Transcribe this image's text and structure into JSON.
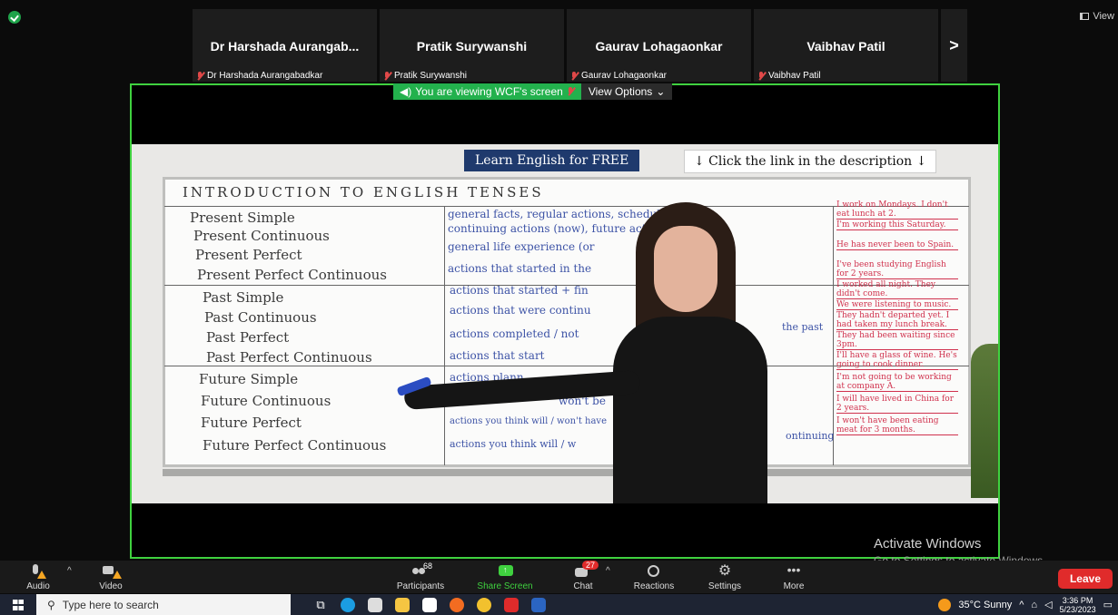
{
  "top": {
    "view_label": "View"
  },
  "participants": [
    {
      "name": "Dr Harshada Aurangab...",
      "sub": "Dr Harshada Aurangabadkar"
    },
    {
      "name": "Pratik Surywanshi",
      "sub": "Pratik Surywanshi"
    },
    {
      "name": "Gaurav Lohagaonkar",
      "sub": "Gaurav Lohagaonkar"
    },
    {
      "name": "Vaibhav Patil",
      "sub": "Vaibhav Patil"
    }
  ],
  "next_label": ">",
  "share": {
    "viewing_text": "You are viewing WCF's screen",
    "options_label": "View Options",
    "learn_text": "Learn English for FREE",
    "click_text": "↓ Click the link in the description ↓",
    "board_title": "INTRODUCTION TO ENGLISH TENSES",
    "tenses": [
      "Present Simple",
      "Present Continuous",
      "Present Perfect",
      "Present Perfect Continuous",
      "Past Simple",
      "Past Continuous",
      "Past Perfect",
      "Past Perfect Continuous",
      "Future Simple",
      "Future Continuous",
      "Future Perfect",
      "Future Perfect Continuous"
    ],
    "usages": [
      "general facts, regular actions, schedules",
      "continuing actions (now), future actions",
      "general life experience (or",
      "actions that started in the",
      "actions that started + fin",
      "actions that were continu",
      "actions completed / not",
      "actions that start",
      "actions plann",
      "won't be",
      "actions you think will / won't have",
      "actions you think will / w"
    ],
    "extras": [
      "the past",
      "ontinuing"
    ],
    "examples": [
      "I work on Mondays. I don't eat lunch at 2.",
      "I'm working this Saturday.",
      "He has never been to Spain.",
      "I've been studying English for 2 years.",
      "I worked all night. They didn't come.",
      "We were listening to music.",
      "They hadn't departed yet. I had taken my lunch break.",
      "They had been waiting since 3pm.",
      "I'll have a glass of wine. He's going to cook dinner.",
      "I'm not going to be working at company A.",
      "I will have lived in China for 2 years.",
      "I won't have been eating meat for 3 months."
    ]
  },
  "watermark": {
    "title": "Activate Windows",
    "sub": "Go to Settings to activate Windows."
  },
  "controls": {
    "audio": "Audio",
    "video": "Video",
    "participants": "Participants",
    "participants_count": "68",
    "share": "Share Screen",
    "chat": "Chat",
    "chat_count": "27",
    "reactions": "Reactions",
    "settings": "Settings",
    "more": "More",
    "leave": "Leave"
  },
  "taskbar": {
    "search_placeholder": "Type here to search",
    "weather": "35°C  Sunny",
    "time": "3:36 PM",
    "date": "5/23/2023"
  },
  "colors": {
    "share_border": "#3fd13f",
    "banner_green": "#23b14d",
    "leave_red": "#e02b2b"
  }
}
